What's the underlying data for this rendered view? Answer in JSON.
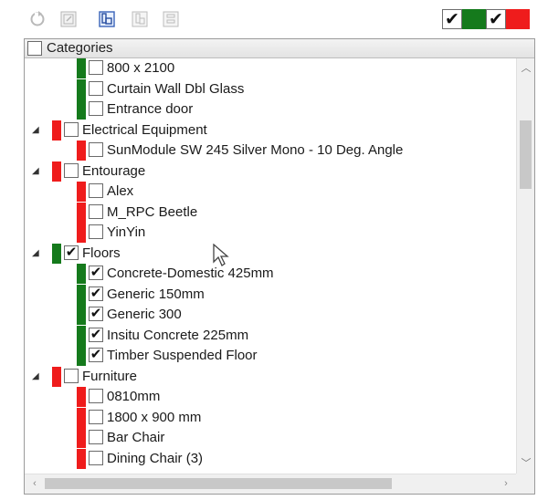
{
  "toolbar": {
    "buttons": [
      {
        "icon": "refresh-icon",
        "enabled": false
      },
      {
        "icon": "collapse-all-icon",
        "enabled": false
      },
      {
        "icon": "expand-all-icon",
        "enabled": true
      },
      {
        "icon": "select-all-icon",
        "enabled": false
      },
      {
        "icon": "deselect-all-icon",
        "enabled": false
      }
    ],
    "legend": {
      "checked_mark": "✔",
      "green_color": "#157a1c",
      "red_color": "#ef1c1c"
    }
  },
  "tree": {
    "header_label": "Categories",
    "header_checked": false,
    "rows": [
      {
        "level": 2,
        "label": "800 x 2100",
        "checked": false,
        "bar": "green"
      },
      {
        "level": 2,
        "label": "Curtain Wall Dbl Glass",
        "checked": false,
        "bar": "green"
      },
      {
        "level": 2,
        "label": "Entrance door",
        "checked": false,
        "bar": "green"
      },
      {
        "level": 1,
        "label": "Electrical Equipment",
        "checked": false,
        "bar": "red",
        "expanded": true
      },
      {
        "level": 2,
        "label": "SunModule SW 245 Silver Mono - 10 Deg. Angle",
        "checked": false,
        "bar": "red"
      },
      {
        "level": 1,
        "label": "Entourage",
        "checked": false,
        "bar": "red",
        "expanded": true
      },
      {
        "level": 2,
        "label": "Alex",
        "checked": false,
        "bar": "red"
      },
      {
        "level": 2,
        "label": "M_RPC Beetle",
        "checked": false,
        "bar": "red"
      },
      {
        "level": 2,
        "label": "YinYin",
        "checked": false,
        "bar": "red"
      },
      {
        "level": 1,
        "label": "Floors",
        "checked": true,
        "bar": "green",
        "expanded": true
      },
      {
        "level": 2,
        "label": "Concrete-Domestic 425mm",
        "checked": true,
        "bar": "green"
      },
      {
        "level": 2,
        "label": "Generic 150mm",
        "checked": true,
        "bar": "green"
      },
      {
        "level": 2,
        "label": "Generic 300",
        "checked": true,
        "bar": "green"
      },
      {
        "level": 2,
        "label": "Insitu Concrete 225mm",
        "checked": true,
        "bar": "green"
      },
      {
        "level": 2,
        "label": "Timber Suspended Floor",
        "checked": true,
        "bar": "green"
      },
      {
        "level": 1,
        "label": "Furniture",
        "checked": false,
        "bar": "red",
        "expanded": true
      },
      {
        "level": 2,
        "label": "0810mm",
        "checked": false,
        "bar": "red"
      },
      {
        "level": 2,
        "label": "1800 x 900 mm",
        "checked": false,
        "bar": "red"
      },
      {
        "level": 2,
        "label": "Bar Chair",
        "checked": false,
        "bar": "red"
      },
      {
        "level": 2,
        "label": "Dining Chair (3)",
        "checked": false,
        "bar": "red"
      }
    ]
  },
  "colors": {
    "green": "#157a1c",
    "red": "#ef1c1c"
  }
}
